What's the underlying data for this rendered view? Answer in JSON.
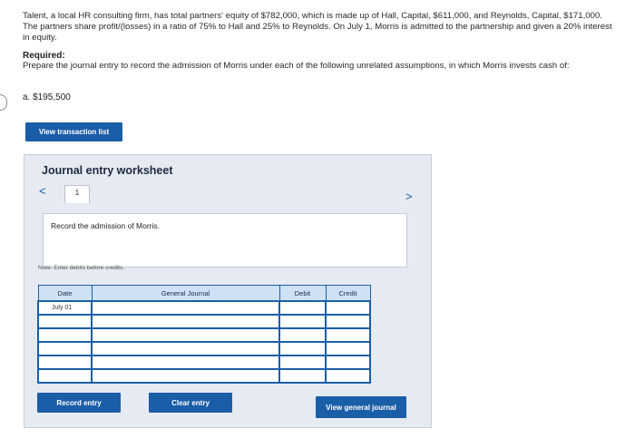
{
  "problem": {
    "text": "Talent, a local HR consulting firm, has total partners' equity of $782,000, which is made up of Hall, Capital, $611,000, and Reynolds, Capital, $171,000. The partners share profit/(losses) in a ratio of 75% to Hall and 25% to Reynolds. On July 1, Morris is admitted to the partnership and given a 20% interest in equity."
  },
  "required": {
    "title": "Required:",
    "text": "Prepare the journal entry to record the admission of Morris under each of the following unrelated assumptions, in which Morris invests cash of:"
  },
  "part": {
    "label": "a. $195,500"
  },
  "buttons": {
    "view_transaction_list": "View transaction list",
    "record_entry": "Record entry",
    "clear_entry": "Clear entry",
    "view_general_journal": "View general journal"
  },
  "worksheet": {
    "title": "Journal entry worksheet",
    "nav_prev": "<",
    "nav_next": ">",
    "tab_number": "1",
    "instruction": "Record the admission of Morris.",
    "note": "Note: Enter debits before credits."
  },
  "journal": {
    "headers": {
      "date": "Date",
      "general_journal": "General Journal",
      "debit": "Debit",
      "credit": "Credit"
    },
    "rows": [
      {
        "date": "July 01",
        "account": "",
        "debit": "",
        "credit": ""
      },
      {
        "date": "",
        "account": "",
        "debit": "",
        "credit": ""
      },
      {
        "date": "",
        "account": "",
        "debit": "",
        "credit": ""
      },
      {
        "date": "",
        "account": "",
        "debit": "",
        "credit": ""
      },
      {
        "date": "",
        "account": "",
        "debit": "",
        "credit": ""
      },
      {
        "date": "",
        "account": "",
        "debit": "",
        "credit": ""
      }
    ]
  },
  "colors": {
    "accent": "#1b5ea8",
    "worksheet_bg": "#e6eaf2"
  }
}
